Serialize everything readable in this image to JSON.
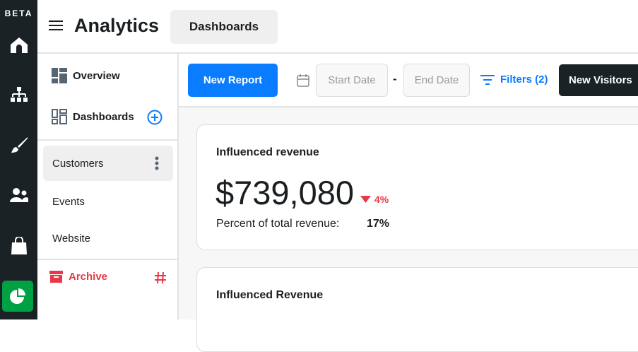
{
  "rail": {
    "badge": "BETA",
    "icons": [
      "home-icon",
      "sitemap-icon",
      "brush-icon",
      "users-icon",
      "shopping-bag-icon",
      "analytics-pie-icon"
    ]
  },
  "header": {
    "title": "Analytics",
    "tab": "Dashboards"
  },
  "sidebar": {
    "overview": "Overview",
    "dashboards": "Dashboards",
    "items": [
      {
        "label": "Customers"
      },
      {
        "label": "Events"
      },
      {
        "label": "Website"
      }
    ],
    "archive": "Archive"
  },
  "toolbar": {
    "new_report": "New Report",
    "start_placeholder": "Start Date",
    "separator": "-",
    "end_placeholder": "End Date",
    "filters": "Filters (2)",
    "new_visitors": "New Visitors"
  },
  "cards": [
    {
      "title": "Influenced revenue",
      "value": "$739,080",
      "change": "4%",
      "sub_label": "Percent of total revenue:",
      "sub_value": "17%"
    },
    {
      "title": "Influenced Revenue"
    }
  ],
  "colors": {
    "accent": "#0a7cff",
    "success": "#00a142",
    "danger": "#e8394a",
    "dark": "#1b2226"
  }
}
